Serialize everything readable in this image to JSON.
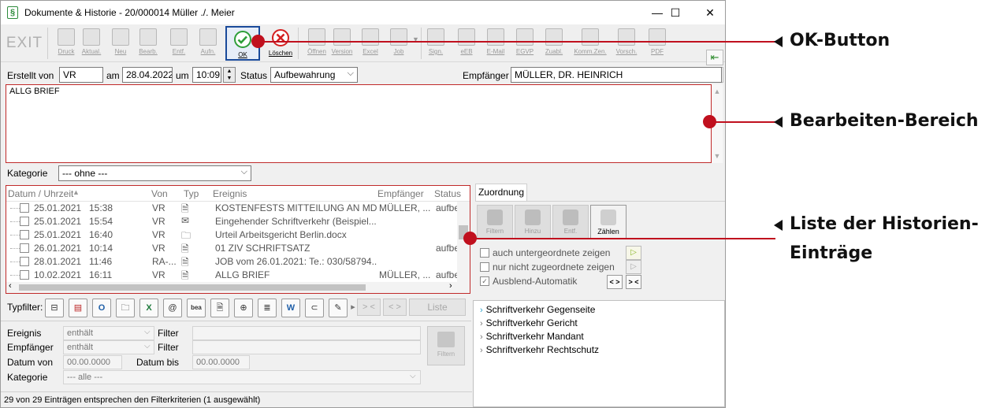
{
  "window": {
    "title": "Dokumente & Historie - 20/000014  Müller ./. Meier",
    "controls": {
      "minimize": "—",
      "maximize": "☐",
      "close": "✕"
    }
  },
  "toolbar": {
    "exit": "EXIT",
    "buttons": [
      {
        "label": "Druck",
        "icon": "printer-icon"
      },
      {
        "label": "Aktual.",
        "icon": "refresh-icon"
      },
      {
        "label": "Neu",
        "icon": "new-icon"
      },
      {
        "label": "Bearb.",
        "icon": "edit-icon"
      },
      {
        "label": "Entf.",
        "icon": "delete-icon"
      },
      {
        "label": "Aufn.",
        "icon": "scan-icon"
      },
      {
        "label": "OK",
        "icon": "check-icon"
      },
      {
        "label": "Löschen",
        "icon": "cancel-icon"
      },
      {
        "label": "Öffnen",
        "icon": "open-icon"
      },
      {
        "label": "Version",
        "icon": "version-icon"
      },
      {
        "label": "Excel",
        "icon": "excel-icon"
      },
      {
        "label": "Job",
        "icon": "job-icon"
      },
      {
        "label": "Sign.",
        "icon": "sign-icon"
      },
      {
        "label": "eEB",
        "icon": "eeb-icon"
      },
      {
        "label": "E-Mail",
        "icon": "email-icon"
      },
      {
        "label": "EGVP",
        "icon": "egvp-icon"
      },
      {
        "label": "Zuabl.",
        "icon": "clipboard-icon"
      },
      {
        "label": "Komm.Zen.",
        "icon": "comm-icon"
      },
      {
        "label": "Vorsch.",
        "icon": "preview-icon"
      },
      {
        "label": "PDF",
        "icon": "pdf-icon"
      }
    ]
  },
  "form": {
    "erstellt_von_label": "Erstellt von",
    "erstellt_von": "VR",
    "am_label": "am",
    "date": "28.04.2022",
    "um_label": "um",
    "time": "10:09",
    "status_label": "Status",
    "status": "Aufbewahrung",
    "empfaenger_label": "Empfänger",
    "empfaenger": "MÜLLER, DR. HEINRICH",
    "text": "ALLG BRIEF",
    "kategorie_label": "Kategorie",
    "kategorie": "--- ohne ---"
  },
  "history": {
    "columns": [
      "Datum / Uhrzeit",
      "Von",
      "Typ",
      "Ereignis",
      "Empfänger",
      "Status"
    ],
    "rows": [
      {
        "date": "25.01.2021",
        "time": "15:38",
        "von": "VR",
        "typ": "doc-icon",
        "ereignis": "KOSTENFESTS  MITTEILUNG AN MDT",
        "empf": "MÜLLER, ...",
        "status": "aufbe"
      },
      {
        "date": "25.01.2021",
        "time": "15:54",
        "von": "VR",
        "typ": "mail-icon",
        "ereignis": "Eingehender Schriftverkehr (Beispiel...",
        "empf": "",
        "status": ""
      },
      {
        "date": "25.01.2021",
        "time": "16:40",
        "von": "VR",
        "typ": "folder-icon",
        "ereignis": "Urteil Arbeitsgericht Berlin.docx",
        "empf": "",
        "status": ""
      },
      {
        "date": "26.01.2021",
        "time": "10:14",
        "von": "VR",
        "typ": "doc-icon",
        "ereignis": "01 ZIV SCHRIFTSATZ",
        "empf": "",
        "status": "aufbe"
      },
      {
        "date": "28.01.2021",
        "time": "11:46",
        "von": "RA-...",
        "typ": "doc-icon",
        "ereignis": "JOB vom 26.01.2021: Te.: 030/58794...",
        "empf": "",
        "status": ""
      },
      {
        "date": "10.02.2021",
        "time": "16:11",
        "von": "VR",
        "typ": "doc-icon",
        "ereignis": "ALLG BRIEF",
        "empf": "MÜLLER, ...",
        "status": "aufbe"
      }
    ]
  },
  "typfilter": {
    "label": "Typfilter:",
    "btn_left": "> <",
    "btn_right": "< >",
    "liste": "Liste"
  },
  "filter": {
    "ereignis_label": "Ereignis",
    "ereignis_mode": "enthält",
    "empfaenger_label": "Empfänger",
    "empfaenger_mode": "enthält",
    "filter_label": "Filter",
    "datum_von_label": "Datum von",
    "datum_von": "00.00.0000",
    "datum_bis_label": "Datum bis",
    "datum_bis": "00.00.0000",
    "kategorie_label": "Kategorie",
    "kategorie": "--- alle ---",
    "filtern": "Filtern"
  },
  "status_text": "29 von 29 Einträgen entsprechen den Filterkriterien (1 ausgewählt)",
  "zuordnung": {
    "tab": "Zuordnung",
    "buttons": [
      "Filtern",
      "Hinzu",
      "Entf.",
      "Zählen"
    ],
    "chk1": "auch untergeordnete zeigen",
    "chk2": "nur nicht zugeordnete zeigen",
    "chk3": "Ausblend-Automatik",
    "lr1": "< >",
    "lr2": "> <",
    "categories": [
      "Schriftverkehr Gegenseite",
      "Schriftverkehr Gericht",
      "Schriftverkehr Mandant",
      "Schriftverkehr Rechtschutz"
    ]
  },
  "annotations": {
    "ok": "OK-Button",
    "edit": "Bearbeiten-Bereich",
    "list_1": "Liste der Historien-",
    "list_2": "Einträge"
  },
  "colors": {
    "annotation_red": "#c0101e",
    "ok_border": "#1a4a9a",
    "check_green": "#2e9e3a",
    "cancel_red": "#d42020"
  }
}
